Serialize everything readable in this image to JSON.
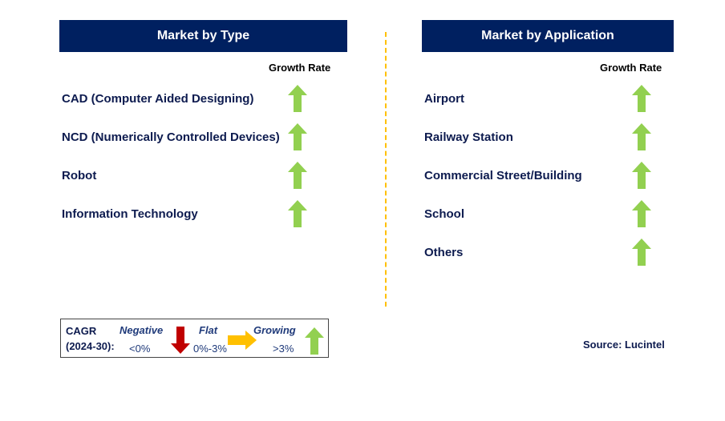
{
  "left_panel": {
    "title": "Market by Type",
    "growth_label": "Growth Rate",
    "items": [
      {
        "label": "CAD (Computer Aided Designing)",
        "trend": "growing"
      },
      {
        "label": "NCD (Numerically Controlled Devices)",
        "trend": "growing"
      },
      {
        "label": "Robot",
        "trend": "growing"
      },
      {
        "label": "Information Technology",
        "trend": "growing"
      }
    ]
  },
  "right_panel": {
    "title": "Market by Application",
    "growth_label": "Growth Rate",
    "items": [
      {
        "label": "Airport",
        "trend": "growing"
      },
      {
        "label": "Railway Station",
        "trend": "growing"
      },
      {
        "label": "Commercial Street/Building",
        "trend": "growing"
      },
      {
        "label": "School",
        "trend": "growing"
      },
      {
        "label": "Others",
        "trend": "growing"
      }
    ]
  },
  "legend": {
    "cagr": "CAGR",
    "period": "(2024-30):",
    "negative": "Negative",
    "negative_range": "<0%",
    "flat": "Flat",
    "flat_range": "0%-3%",
    "growing": "Growing",
    "growing_range": ">3%"
  },
  "source": "Source: Lucintel",
  "colors": {
    "header": "#002060",
    "growing": "#92d050",
    "negative": "#c00000",
    "flat": "#ffc000",
    "divider": "#ffc000"
  }
}
